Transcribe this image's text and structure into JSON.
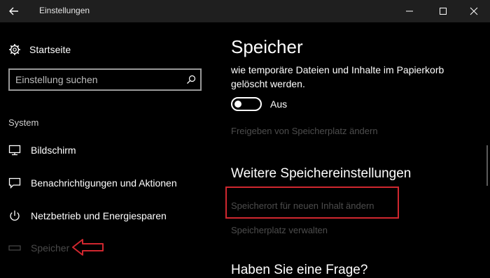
{
  "window": {
    "title": "Einstellungen",
    "icons": {
      "back": "back-arrow-icon",
      "minimize": "minimize-icon",
      "maximize": "maximize-icon",
      "close": "close-icon"
    }
  },
  "sidebar": {
    "home_label": "Startseite",
    "search_placeholder": "Einstellung suchen",
    "section_label": "System",
    "items": [
      {
        "label": "Bildschirm",
        "icon": "monitor-icon"
      },
      {
        "label": "Benachrichtigungen und Aktionen",
        "icon": "notification-icon"
      },
      {
        "label": "Netzbetrieb und Energiesparen",
        "icon": "power-icon"
      },
      {
        "label": "Speicher",
        "icon": "storage-icon",
        "selected": true
      }
    ]
  },
  "main": {
    "title": "Speicher",
    "description": "wie temporäre Dateien und Inhalte im Papierkorb gelöscht werden.",
    "toggle": {
      "state_label": "Aus",
      "on": false
    },
    "link_free_space": "Freigeben von Speicherplatz ändern",
    "more_heading": "Weitere Speichereinstellungen",
    "link_change_location": "Speicherort für neuen Inhalt ändern",
    "link_manage_spaces": "Speicherplatz verwalten",
    "bottom_heading": "Haben Sie eine Frage?"
  },
  "annotations": {
    "highlight_color": "#d0272f"
  }
}
